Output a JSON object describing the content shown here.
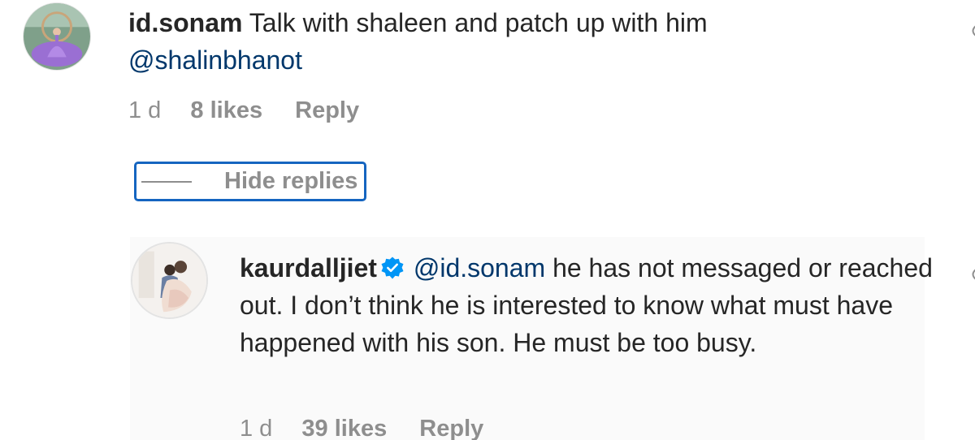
{
  "comments": [
    {
      "username": "id.sonam",
      "text": "Talk with shaleen and patch up with him",
      "mention": "@shalinbhanot",
      "time": "1 d",
      "likes": "8 likes",
      "reply_label": "Reply",
      "avatar_icon": "profile-photo-purple-gown"
    }
  ],
  "hide_replies": {
    "label": "Hide replies"
  },
  "replies": [
    {
      "username": "kaurdalljiet",
      "verified": true,
      "mention": "@id.sonam",
      "text": "he has not messaged or reached out. I don’t think he is interested to know what must have happened with his son. He must be too busy.",
      "time": "1 d",
      "likes": "39 likes",
      "reply_label": "Reply",
      "avatar_icon": "profile-photo-couple"
    }
  ],
  "colors": {
    "text": "#262626",
    "meta": "#8e8e8e",
    "mention": "#00376b",
    "verified": "#0095f6",
    "focus_outline": "#1565c0",
    "reply_background": "#fafafa"
  }
}
